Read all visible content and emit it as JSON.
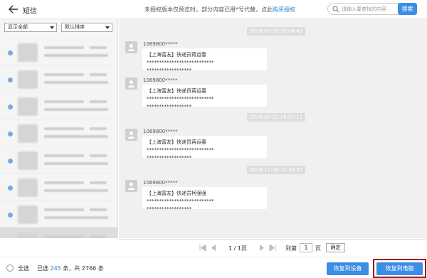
{
  "header": {
    "title": "短信",
    "notice_prefix": "未授权版本仅预览时，部分内容已用*号代替，点此",
    "notice_link": "购买授权",
    "search_placeholder": "请输入要查找的内容",
    "search_button": "搜索"
  },
  "filters": {
    "show": "显示全部",
    "sort": "默认排序"
  },
  "conversations_count": 8,
  "messages": [
    {
      "date": "2018-07-20 16:04:40",
      "sender": "1069800*****",
      "line1": "【上海富友】快递员蒋运春***************************",
      "line2": "******************"
    },
    {
      "date": "",
      "sender": "1069800*****",
      "line1": "【上海富友】快递员蒋运春***************************",
      "line2": "******************"
    },
    {
      "date": "2018-07-22 18:07:11",
      "sender": "1069800*****",
      "line1": "【上海富友】快递员蒋运春***************************",
      "line2": "******************"
    },
    {
      "date": "2018-11-16 13:33:07",
      "sender": "1069800*****",
      "line1": "【上海富友】快递员柯强强***************************",
      "line2": "******************"
    }
  ],
  "pager": {
    "page": "1 / 1页",
    "goto_prefix": "到第",
    "goto_value": "1",
    "goto_suffix": "页",
    "confirm": "确定"
  },
  "footer": {
    "select_all": "全选",
    "selected_prefix": "已选 ",
    "selected_count": "245",
    "selected_suffix": " 条，共 2766 条",
    "restore_device": "恢复到设备",
    "restore_pc": "恢复到电脑"
  }
}
